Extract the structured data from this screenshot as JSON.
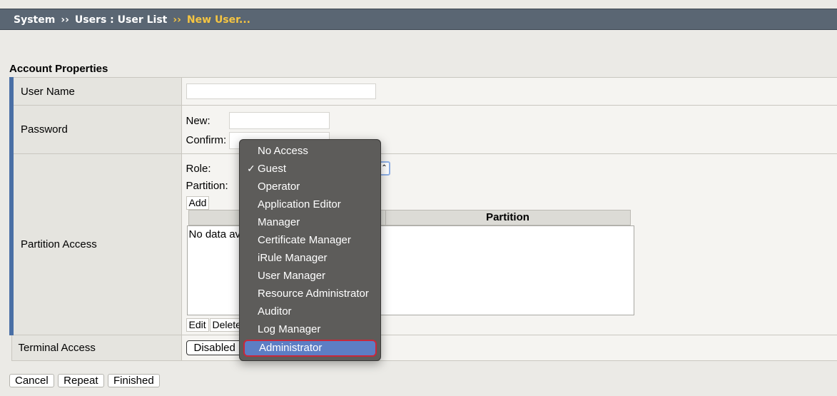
{
  "breadcrumb": {
    "system": "System",
    "users": "Users : User List",
    "current": "New User...",
    "sep": "››"
  },
  "section_title": "Account Properties",
  "fields": {
    "user_name_label": "User Name",
    "password_label": "Password",
    "new_label": "New:",
    "confirm_label": "Confirm:",
    "partition_access_label": "Partition Access",
    "role_label": "Role:",
    "partition_label": "Partition:",
    "add_button": "Add",
    "partition_column": "Partition",
    "no_data": "No data av",
    "edit_button": "Edit",
    "delete_button": "Delete",
    "terminal_access_label": "Terminal Access",
    "terminal_access_value": "Disabled"
  },
  "role_menu": {
    "selected_check": "Guest",
    "highlighted": "Administrator",
    "items": [
      "No Access",
      "Guest",
      "Operator",
      "Application Editor",
      "Manager",
      "Certificate Manager",
      "iRule Manager",
      "User Manager",
      "Resource Administrator",
      "Auditor",
      "Log Manager",
      "Administrator"
    ]
  },
  "buttons": {
    "cancel": "Cancel",
    "repeat": "Repeat",
    "finished": "Finished"
  },
  "colors": {
    "header_bg": "#5a6673",
    "breadcrumb_current": "#f5c542",
    "required_bar": "#4a6fa5",
    "menu_bg": "#5d5c5a",
    "menu_highlight": "#5d7ec4",
    "highlight_outline": "#c8283a"
  }
}
